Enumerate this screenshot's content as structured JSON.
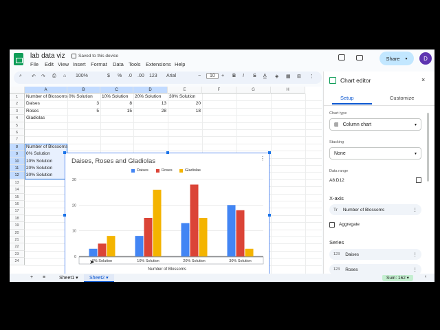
{
  "app": {
    "doc_title": "lab data viz",
    "saved_status": "Saved to this device",
    "menus": [
      "File",
      "Edit",
      "View",
      "Insert",
      "Format",
      "Data",
      "Tools",
      "Extensions",
      "Help"
    ],
    "share_label": "Share",
    "avatar_initial": "D"
  },
  "toolbar": {
    "zoom": "100%",
    "currency": "$",
    "percent": "%",
    "dec_down": ".0",
    "dec_up": ".00",
    "number_format": "123",
    "font": "Arial",
    "font_size": "10",
    "minus": "−",
    "plus": "+",
    "bold": "B",
    "italic": "I",
    "strike": "S",
    "text_color": "A"
  },
  "grid": {
    "columns": [
      "A",
      "B",
      "C",
      "D",
      "E",
      "F",
      "G",
      "H"
    ],
    "rows": [
      "1",
      "2",
      "3",
      "4",
      "5",
      "6",
      "7",
      "8",
      "9",
      "10",
      "11",
      "12",
      "13",
      "14",
      "15",
      "16",
      "17",
      "18",
      "19",
      "20",
      "21",
      "22",
      "23",
      "24"
    ],
    "header_row": [
      "Number of Blossoms",
      "0% Solution",
      "10% Solution",
      "20% Solution",
      "30% Solution"
    ],
    "data_rows": [
      [
        "Daises",
        "3",
        "8",
        "13",
        "20"
      ],
      [
        "Roses",
        "5",
        "15",
        "28",
        "18"
      ],
      [
        "Gladiolas",
        "",
        "",
        "",
        ""
      ]
    ],
    "selection_col": [
      "Number of Blossoms",
      "0% Solution",
      "10% Solution",
      "20% Solution",
      "30% Solution"
    ]
  },
  "chart_data": {
    "type": "bar",
    "title": "Daises, Roses and Gladiolas",
    "xlabel": "Number of Blossoms",
    "ylabel": "",
    "categories": [
      "0% Solution",
      "10% Solution",
      "20% Solution",
      "30% Solution"
    ],
    "series": [
      {
        "name": "Daises",
        "values": [
          3,
          8,
          13,
          20
        ],
        "color": "#4285f4"
      },
      {
        "name": "Roses",
        "values": [
          5,
          15,
          28,
          18
        ],
        "color": "#db4437"
      },
      {
        "name": "Gladiolas",
        "values": [
          8,
          26,
          15,
          3
        ],
        "color": "#f4b400"
      }
    ],
    "yticks": [
      0,
      10,
      20,
      30
    ],
    "ylim": [
      0,
      30
    ],
    "legend": "top",
    "grid": true
  },
  "sheets": {
    "add": "+",
    "menu": "≡",
    "tabs": [
      "Sheet1",
      "Sheet2"
    ],
    "active": "Sheet2",
    "sum": "Sum: 162"
  },
  "editor": {
    "title": "Chart editor",
    "tabs": [
      "Setup",
      "Customize"
    ],
    "chart_type_label": "Chart type",
    "chart_type_value": "Column chart",
    "stacking_label": "Stacking",
    "stacking_value": "None",
    "data_range_label": "Data range",
    "data_range_value": "A8:D12",
    "xaxis_label": "X-axis",
    "xaxis_value": "Number of Blossoms",
    "aggregate_label": "Aggregate",
    "series_label": "Series",
    "series_items": [
      "Daises",
      "Roses"
    ],
    "series_icon": "123",
    "xaxis_icon": "Tr"
  }
}
